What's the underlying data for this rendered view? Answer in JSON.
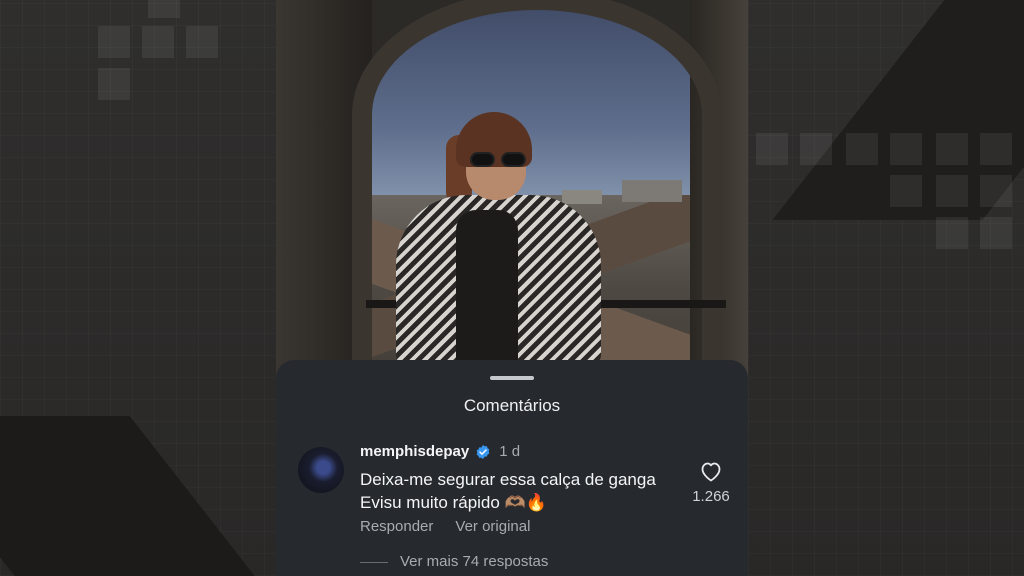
{
  "comments_sheet": {
    "title": "Comentários",
    "comment": {
      "username": "memphisdepay",
      "verified": true,
      "time": "1 d",
      "text": "Deixa-me segurar essa calça de ganga Evisu muito rápido 🫶🏽🔥",
      "like_count": "1.266",
      "reply_label": "Responder",
      "translate_label": "Ver original",
      "more_replies": "Ver mais 74 respostas"
    }
  },
  "icons": {
    "verified": "verified-badge-icon",
    "like": "heart-icon"
  },
  "colors": {
    "sheet_bg": "#262a2e",
    "verified_blue": "#3897f0",
    "muted_text": "#a8acb2"
  }
}
